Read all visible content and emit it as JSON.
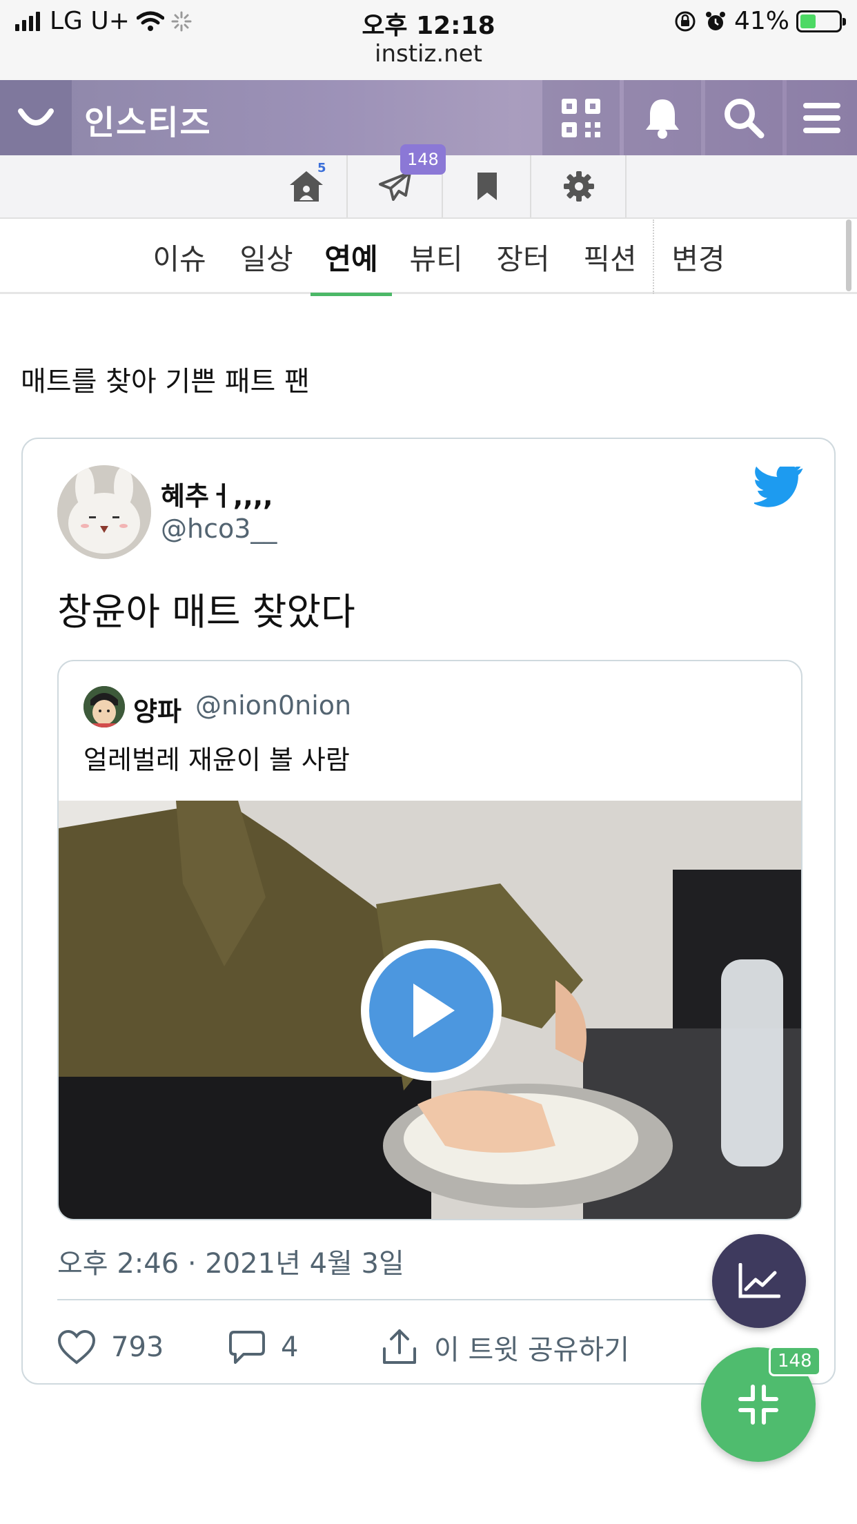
{
  "status_bar": {
    "carrier": "LG U+",
    "time": "오후 12:18",
    "url": "instiz.net",
    "battery": "41%",
    "battery_level": 0.41
  },
  "header": {
    "brand": "인스티즈",
    "icons": [
      "loading-icon",
      "qr-code-icon",
      "bell-icon",
      "search-icon",
      "menu-icon"
    ]
  },
  "toolbar": {
    "home_count": "5",
    "messages_badge": "148",
    "icons": [
      "home-icon",
      "paper-plane-icon",
      "bookmark-icon",
      "gear-icon"
    ]
  },
  "tabs": [
    {
      "label": "이슈"
    },
    {
      "label": "일상"
    },
    {
      "label": "연예"
    },
    {
      "label": "뷰티"
    },
    {
      "label": "장터"
    },
    {
      "label": "픽션"
    },
    {
      "label": "변경"
    }
  ],
  "post": {
    "title": "매트를 찾아 기쁜 패트 팬"
  },
  "tweet": {
    "name": "혜추ㅓ,,,,",
    "handle": "@hco3__",
    "text": "창윤아 매트 찾았다",
    "quote": {
      "name": "양파",
      "handle": "@nion0nion",
      "text": "얼레벌레 재윤이 볼 사람"
    },
    "date": "오후 2:46 · 2021년 4월 3일",
    "likes": "793",
    "replies": "4",
    "share_label": "이 트윗 공유하기"
  },
  "fab": {
    "badge": "148"
  },
  "colors": {
    "header": "#9d92b8",
    "active_tab": "#4bb867",
    "twitter_blue": "#1d9bf0",
    "play_blue": "#4c97df",
    "fab_stats": "#3e3a5e",
    "fab_collapse": "#4fbc6e"
  }
}
